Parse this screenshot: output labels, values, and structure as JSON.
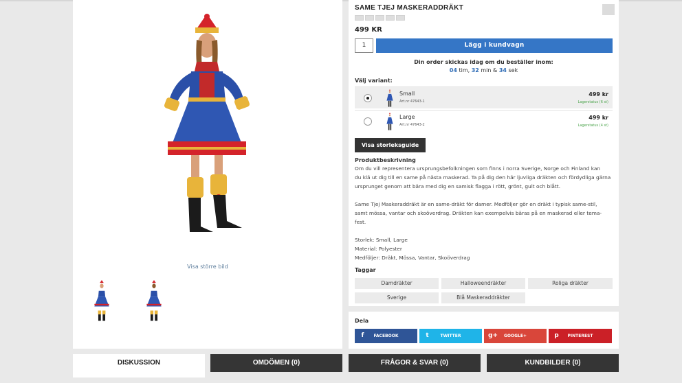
{
  "product": {
    "title": "SAME TJEJ MASKERADDRÄKT",
    "price": "499 KR",
    "quantity": "1",
    "add_to_cart": "Lägg i kundvagn",
    "shipping_line": "Din order skickas idag om du beställer inom:",
    "countdown": {
      "hours": "04",
      "hours_unit": "tim,",
      "minutes": "32",
      "minutes_unit": "min &",
      "seconds": "34",
      "seconds_unit": "sek"
    },
    "variant_label": "Välj variant:",
    "variants": [
      {
        "name": "Small",
        "art": "Art.nr 47643-1",
        "price": "499 kr",
        "stock": "Lagerstatus (6 st)",
        "selected": true
      },
      {
        "name": "Large",
        "art": "Art.nr 47643-2",
        "price": "499 kr",
        "stock": "Lagerstatus (4 st)",
        "selected": false
      }
    ],
    "size_guide": "Visa storleksguide",
    "description_title": "Produktbeskrivning",
    "description": [
      "Om du vill representera ursprungsbefolkningen som finns i norra Sverige, Norge och Finland kan",
      "du klä ut dig till en same på nästa maskerad. Ta på dig den här ljuvliga dräkten och fördydliga gärna",
      "ursprunget genom att bära med dig en samisk flagga i rött, grönt, gult och blått.",
      "Same Tjej Maskeraddräkt är en same-dräkt för damer. Medföljer gör en dräkt i typisk same-stil,",
      "samt mössa, vantar och skoöverdrag. Dräkten kan exempelvis bäras på en maskerad eller tema-",
      "fest.",
      "Storlek: Small, Large",
      "Material: Polyester",
      "Medföljer: Dräkt, Mössa, Vantar, Skoöverdrag"
    ],
    "tags_title": "Taggar",
    "tags": [
      "Damdräkter",
      "Halloweendräkter",
      "Roliga dräkter",
      "Sverige",
      "Blå Maskeraddräkter"
    ]
  },
  "gallery": {
    "view_larger": "Visa större bild"
  },
  "share": {
    "title": "Dela",
    "buttons": [
      {
        "label": "FACEBOOK",
        "icon": "f",
        "color": "#2f5597"
      },
      {
        "label": "TWITTER",
        "icon": "t",
        "color": "#1fb4e8"
      },
      {
        "label": "GOOGLE+",
        "icon": "g+",
        "color": "#d9463a"
      },
      {
        "label": "PINTEREST",
        "icon": "p",
        "color": "#cb2027"
      }
    ]
  },
  "tabs": [
    "DISKUSSION",
    "OMDÖMEN (0)",
    "FRÅGOR & SVAR (0)",
    "KUNDBILDER (0)"
  ]
}
